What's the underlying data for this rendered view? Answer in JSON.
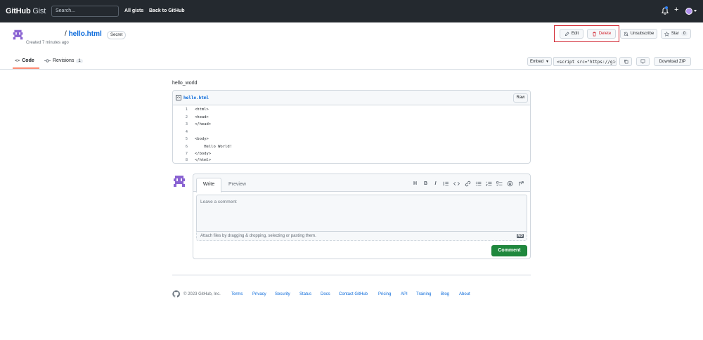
{
  "topbar": {
    "logo_main": "GitHub",
    "logo_sub": "Gist",
    "search_placeholder": "Search...",
    "nav": [
      "All gists",
      "Back to GitHub"
    ]
  },
  "gist": {
    "separator": "/",
    "filename": "hello.html",
    "visibility": "Secret",
    "created": "Created 7 minutes ago",
    "description": "hello_world"
  },
  "actions": {
    "edit": "Edit",
    "delete": "Delete",
    "unsubscribe": "Unsubscribe",
    "star": "Star",
    "star_count": "0"
  },
  "tabs": {
    "code": "Code",
    "revisions": "Revisions",
    "revisions_count": "1"
  },
  "toolbar": {
    "embed": "Embed",
    "embed_url": "<script src=\"https://gis",
    "download": "Download ZIP"
  },
  "file": {
    "icon_text": "<>",
    "name": "hello.html",
    "raw": "Raw",
    "lines": [
      {
        "n": "1",
        "code": "<html>"
      },
      {
        "n": "2",
        "code": "<head>"
      },
      {
        "n": "3",
        "code": "</head>"
      },
      {
        "n": "4",
        "code": ""
      },
      {
        "n": "5",
        "code": "<body>"
      },
      {
        "n": "6",
        "code": "    Hello World!"
      },
      {
        "n": "7",
        "code": "</body>"
      },
      {
        "n": "8",
        "code": "</html>"
      }
    ]
  },
  "comment": {
    "write_tab": "Write",
    "preview_tab": "Preview",
    "toolbar_icons": [
      "H",
      "B",
      "I"
    ],
    "placeholder": "Leave a comment",
    "attach_text": "Attach files by dragging & dropping, selecting or pasting them.",
    "markdown_badge": "MD",
    "submit": "Comment"
  },
  "footer": {
    "copyright": "© 2023 GitHub, Inc.",
    "links": [
      "Terms",
      "Privacy",
      "Security",
      "Status",
      "Docs",
      "Contact GitHub",
      "Pricing",
      "API",
      "Training",
      "Blog",
      "About"
    ]
  }
}
